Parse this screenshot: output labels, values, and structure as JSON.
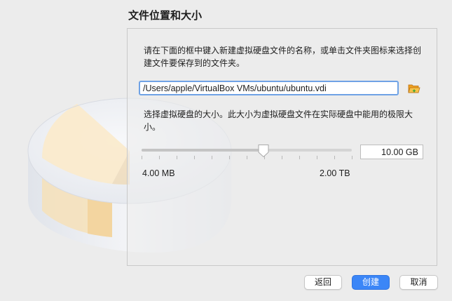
{
  "page": {
    "title": "文件位置和大小"
  },
  "location": {
    "description": "请在下面的框中键入新建虚拟硬盘文件的名称，或单击文件夹图标来选择创建文件要保存到的文件夹。",
    "path_value": "/Users/apple/VirtualBox VMs/ubuntu/ubuntu.vdi",
    "folder_icon": "folder-open-icon"
  },
  "size": {
    "description": "选择虚拟硬盘的大小。此大小为虚拟硬盘文件在实际硬盘中能用的极限大小。",
    "value": "10.00 GB",
    "slider_fraction": 0.58,
    "min_label": "4.00 MB",
    "max_label": "2.00 TB"
  },
  "buttons": {
    "back": "返回",
    "create": "创建",
    "cancel": "取消"
  },
  "colors": {
    "accent": "#3b86f7",
    "input_focus": "#6fa2e5",
    "folder": "#f0a020"
  }
}
